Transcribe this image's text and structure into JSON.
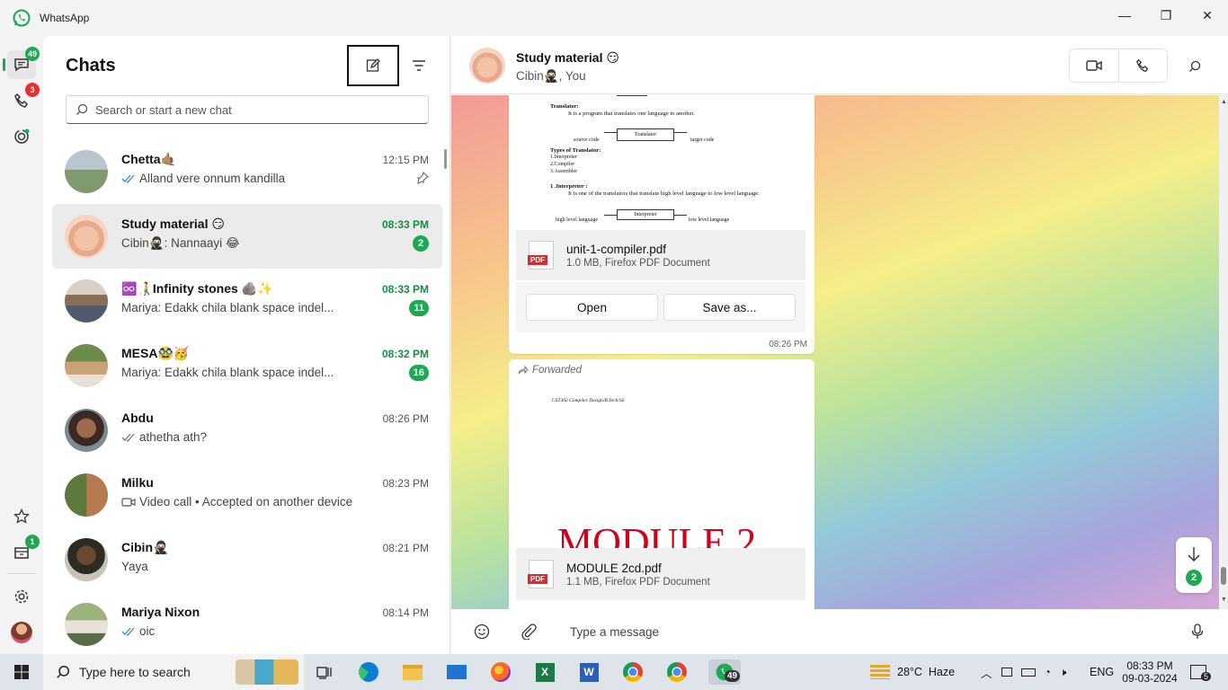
{
  "app": {
    "title": "WhatsApp",
    "minimize": "—",
    "maximize": "❐",
    "close": "✕"
  },
  "rail": {
    "chats_badge": "49",
    "calls_badge": "3",
    "archived_badge": "1"
  },
  "panel": {
    "title": "Chats",
    "search_placeholder": "Search or start a new chat",
    "chats": [
      {
        "name": "Chetta🤙🏽",
        "preview": "Alland vere onnum kandilla",
        "time": "12:15 PM",
        "ticks": true,
        "pinned": true,
        "unread": ""
      },
      {
        "name": "Study material 😏",
        "preview": "Cibin🥷🏻: Nannaayi 😂",
        "time": "08:33 PM",
        "ticks": false,
        "pinned": false,
        "unread": "2"
      },
      {
        "name": "♾️🧑‍🦯Infinity stones 🪨✨",
        "preview": "Mariya: Edakk chila blank space indel...",
        "time": "08:33 PM",
        "ticks": false,
        "pinned": false,
        "unread": "11"
      },
      {
        "name": "MESA🥸🥳",
        "preview": "Mariya: Edakk chila blank space indel...",
        "time": "08:32 PM",
        "ticks": false,
        "pinned": false,
        "unread": "16"
      },
      {
        "name": "Abdu",
        "preview": "athetha ath?",
        "time": "08:26 PM",
        "ticks": true,
        "pinned": false,
        "unread": ""
      },
      {
        "name": "Milku",
        "preview": "Video call • Accepted on another device",
        "time": "08:23 PM",
        "ticks": false,
        "pinned": false,
        "unread": ""
      },
      {
        "name": "Cibin🥷🏻",
        "preview": "Yaya",
        "time": "08:21 PM",
        "ticks": false,
        "pinned": false,
        "unread": ""
      },
      {
        "name": "Mariya Nixon",
        "preview": "oic",
        "time": "08:14 PM",
        "ticks": true,
        "pinned": false,
        "unread": ""
      }
    ]
  },
  "conversation": {
    "title": "Study material 😏",
    "subtitle": "Cibin🥷🏻, You",
    "msg1": {
      "doc_lines": {
        "translator_h": "Translator:",
        "translator_d": "It is a program that translates one language to another.",
        "src": "source code",
        "box1": "Translator",
        "tgt": "target code",
        "types_h": "Types of Translator:",
        "t1": "1.Interpreter",
        "t2": "2.Compiler",
        "t3": "3.Assembler",
        "interp_h": "1 .Interpreter :",
        "interp_d": "It is one of the translators that translate high level language to low level language.",
        "hll": "high level language",
        "box2": "Interpreter",
        "lll": "low level language"
      },
      "file_name": "unit-1-compiler.pdf",
      "file_meta": "1.0 MB, Firefox PDF Document",
      "open": "Open",
      "save": "Save as...",
      "time": "08:26 PM"
    },
    "msg2": {
      "forwarded": "Forwarded",
      "doc_header": "CST302 Compiler Design/B.Tech/S6",
      "doc_title": "MODULE 2",
      "file_name": "MODULE 2cd.pdf",
      "file_meta": "1.1 MB, Firefox PDF Document"
    },
    "jump_badge": "2",
    "composer_placeholder": "Type a message"
  },
  "taskbar": {
    "search_placeholder": "Type here to search",
    "whatsapp_badge": "49",
    "weather": "28°C  Haze",
    "lang": "ENG",
    "time": "08:33 PM",
    "date": "09-03-2024",
    "notif": "5"
  },
  "colors": {
    "accent": "#1da851",
    "unread_time": "#1a8a44",
    "red_badge": "#e0312c"
  }
}
